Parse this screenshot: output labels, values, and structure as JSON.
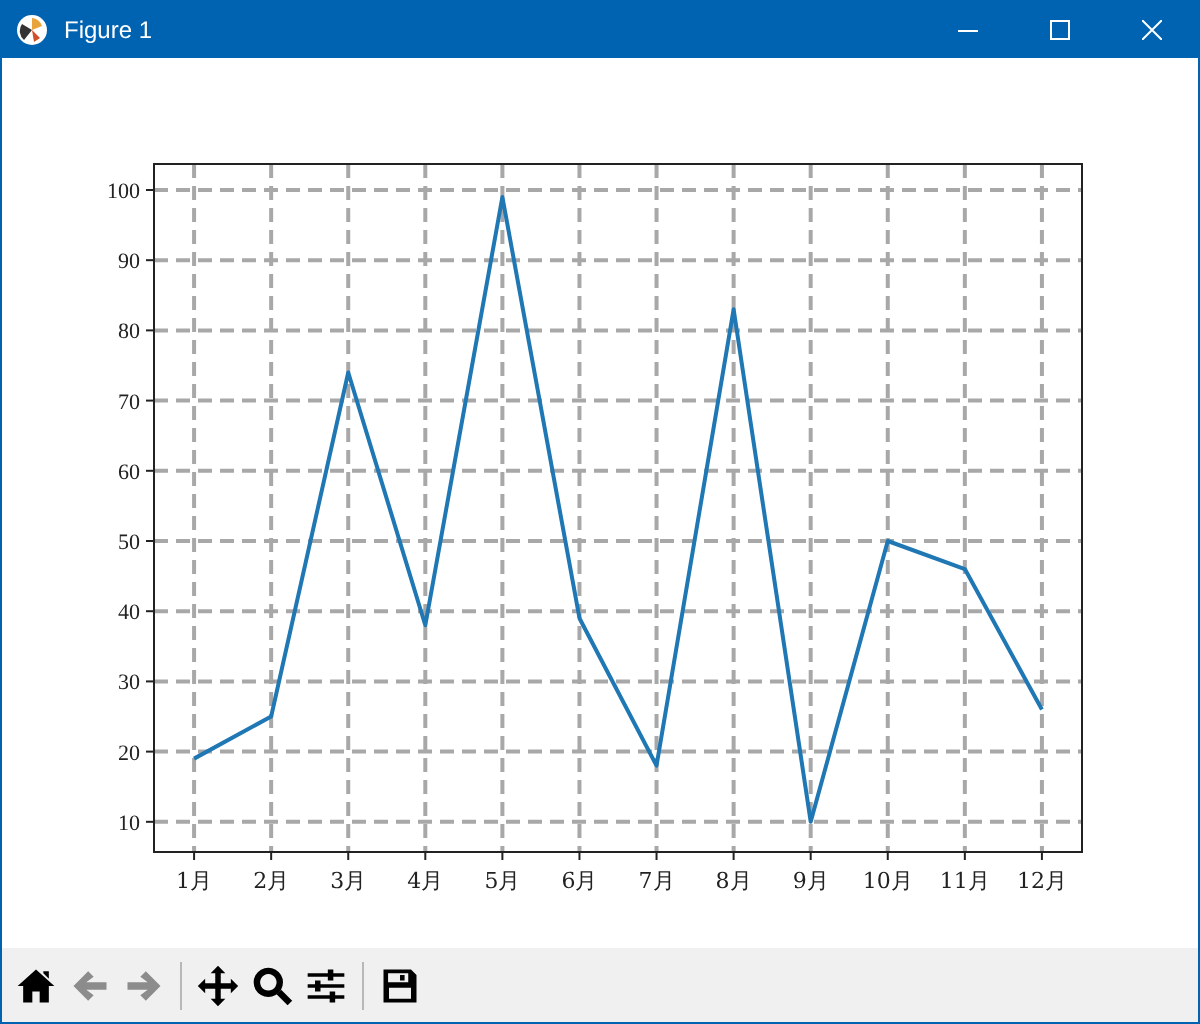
{
  "window": {
    "title": "Figure 1"
  },
  "figure": {
    "chart_data": {
      "type": "line",
      "categories": [
        "1月",
        "2月",
        "3月",
        "4月",
        "5月",
        "6月",
        "7月",
        "8月",
        "9月",
        "10月",
        "11月",
        "12月"
      ],
      "grid": true,
      "series": [
        {
          "color": "#1f77b4",
          "values": [
            19,
            25,
            74,
            38,
            99,
            39,
            18,
            83,
            10,
            50,
            46,
            26
          ]
        }
      ],
      "ylim": [
        5.7,
        103.7
      ],
      "yticks": [
        10,
        20,
        30,
        40,
        50,
        60,
        70,
        80,
        90,
        100
      ]
    }
  },
  "toolbar": [
    {
      "kind": "home",
      "disabled": false
    },
    {
      "kind": "back",
      "disabled": true
    },
    {
      "kind": "forward",
      "disabled": true
    },
    {
      "kind": "separator"
    },
    {
      "kind": "move",
      "disabled": false
    },
    {
      "kind": "zoom",
      "disabled": false
    },
    {
      "kind": "configure",
      "disabled": false
    },
    {
      "kind": "separator"
    },
    {
      "kind": "save",
      "disabled": false
    }
  ]
}
